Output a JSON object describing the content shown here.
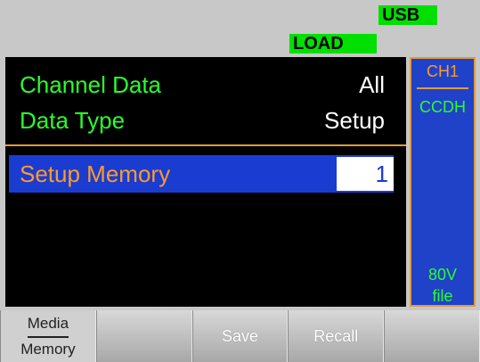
{
  "status": {
    "usb": "USB",
    "load": "LOAD"
  },
  "colors": {
    "badge": "#00e000",
    "label_green": "#2aff2a",
    "accent_orange": "#ff9a2a",
    "selection_blue": "#1a3cd0",
    "panel_black": "#000000"
  },
  "settings": {
    "channel_data": {
      "label": "Channel Data",
      "value": "All"
    },
    "data_type": {
      "label": "Data Type",
      "value": "Setup"
    },
    "setup_memory": {
      "label": "Setup Memory",
      "value": "1"
    }
  },
  "side_panel": {
    "channel": "CH1",
    "mode": "CCDH",
    "voltage": "80V",
    "file": "file"
  },
  "softkeys": {
    "media_top": "Media",
    "media_bottom": "Memory",
    "key2": "",
    "save": "Save",
    "recall": "Recall",
    "key5": ""
  }
}
